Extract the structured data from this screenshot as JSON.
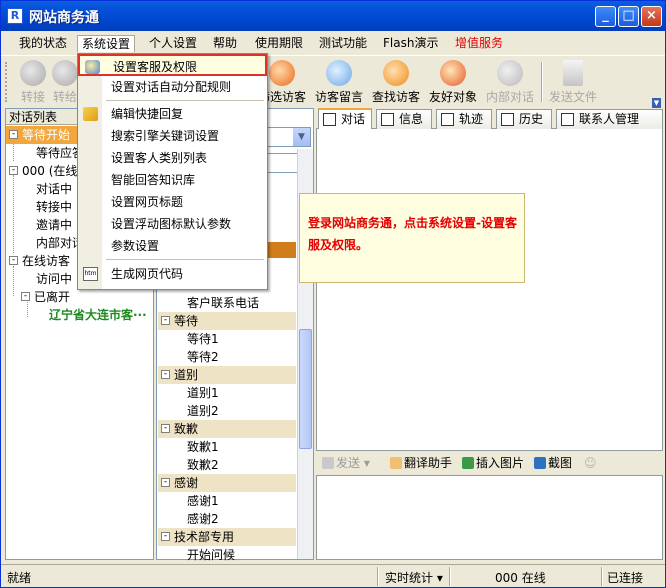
{
  "window": {
    "title": "网站商务通",
    "app_icon": "R"
  },
  "menubar": {
    "items": [
      {
        "label": "我的状态"
      },
      {
        "label": "系统设置",
        "active": true
      },
      {
        "label": "个人设置"
      },
      {
        "label": "帮助"
      },
      {
        "label": "使用期限"
      },
      {
        "label": "测试功能"
      },
      {
        "label": "Flash演示"
      },
      {
        "label": "增值服务",
        "color": "#e00000"
      }
    ]
  },
  "toolbar": {
    "items": [
      {
        "label": "转接",
        "icon": "transfer-icon",
        "disabled": true
      },
      {
        "label": "转给",
        "icon": "forward-icon",
        "disabled": true
      },
      {
        "label": "筛选访客",
        "icon": "filter-visitor-icon"
      },
      {
        "label": "访客留言",
        "icon": "visitor-message-icon"
      },
      {
        "label": "查找访客",
        "icon": "find-visitor-icon"
      },
      {
        "label": "友好对象",
        "icon": "friendly-object-icon"
      },
      {
        "label": "内部对话",
        "icon": "internal-chat-icon",
        "disabled": true
      },
      {
        "label": "发送文件",
        "icon": "send-file-icon",
        "disabled": true
      }
    ]
  },
  "left_panel": {
    "header": "对话列表",
    "tree": [
      {
        "label": "等待开始",
        "level": 0,
        "expander": "-",
        "selected": true
      },
      {
        "label": "等待应答",
        "level": 1
      },
      {
        "label": "000 (在线",
        "level": 0,
        "expander": "-"
      },
      {
        "label": "对话中",
        "level": 1
      },
      {
        "label": "转接中",
        "level": 1
      },
      {
        "label": "邀请中",
        "level": 1
      },
      {
        "label": "内部对话",
        "level": 1
      },
      {
        "label": "在线访客",
        "level": 0,
        "expander": "-"
      },
      {
        "label": "访问中",
        "level": 1
      },
      {
        "label": "已离开",
        "level": 1,
        "expander": "-"
      },
      {
        "label": "辽宁省大连市客···",
        "level": 2,
        "green": true
      }
    ]
  },
  "middle_panel": {
    "rows": [
      {
        "label": "客户联系电话",
        "type": "item"
      },
      {
        "label": "等待",
        "type": "category"
      },
      {
        "label": "等待1",
        "type": "item"
      },
      {
        "label": "等待2",
        "type": "item"
      },
      {
        "label": "道别",
        "type": "category"
      },
      {
        "label": "道别1",
        "type": "item"
      },
      {
        "label": "道别2",
        "type": "item"
      },
      {
        "label": "致歉",
        "type": "category"
      },
      {
        "label": "致歉1",
        "type": "item"
      },
      {
        "label": "致歉2",
        "type": "item"
      },
      {
        "label": "感谢",
        "type": "category"
      },
      {
        "label": "感谢1",
        "type": "item"
      },
      {
        "label": "感谢2",
        "type": "item"
      },
      {
        "label": "技术部专用",
        "type": "category"
      },
      {
        "label": "开始问候",
        "type": "item"
      }
    ]
  },
  "right_panel": {
    "tabs": [
      {
        "label": "对话",
        "active": true
      },
      {
        "label": "信息"
      },
      {
        "label": "轨迹"
      },
      {
        "label": "历史"
      },
      {
        "label": "联系人管理"
      }
    ],
    "tip": "登录网站商务通，点击系统设置-设置客服及权限。",
    "send_bar": {
      "send_label": "发送",
      "translate_label": "翻译助手",
      "insert_image_label": "插入图片",
      "screenshot_label": "截图"
    }
  },
  "dropdown": {
    "items": [
      {
        "label": "设置客服及权限",
        "highlighted": true,
        "icon": "users-icon"
      },
      {
        "label": "设置对话自动分配规则"
      },
      {
        "label": "编辑快捷回复",
        "icon": "edit-icon",
        "separator_before": true
      },
      {
        "label": "搜索引擎关键词设置"
      },
      {
        "label": "设置客人类别列表"
      },
      {
        "label": "智能回答知识库"
      },
      {
        "label": "设置网页标题"
      },
      {
        "label": "设置浮动图标默认参数"
      },
      {
        "label": "参数设置"
      },
      {
        "label": "生成网页代码",
        "icon": "htm-icon",
        "separator_before": true
      }
    ]
  },
  "statusbar": {
    "status": "就绪",
    "stats_label": "实时统计",
    "online_text": "000 在线",
    "connection": "已连接"
  },
  "colors": {
    "title_bar": "#0450d8",
    "selection": "#f1a73c",
    "tip_text": "#e30000",
    "highlight_border": "#e0302a"
  }
}
